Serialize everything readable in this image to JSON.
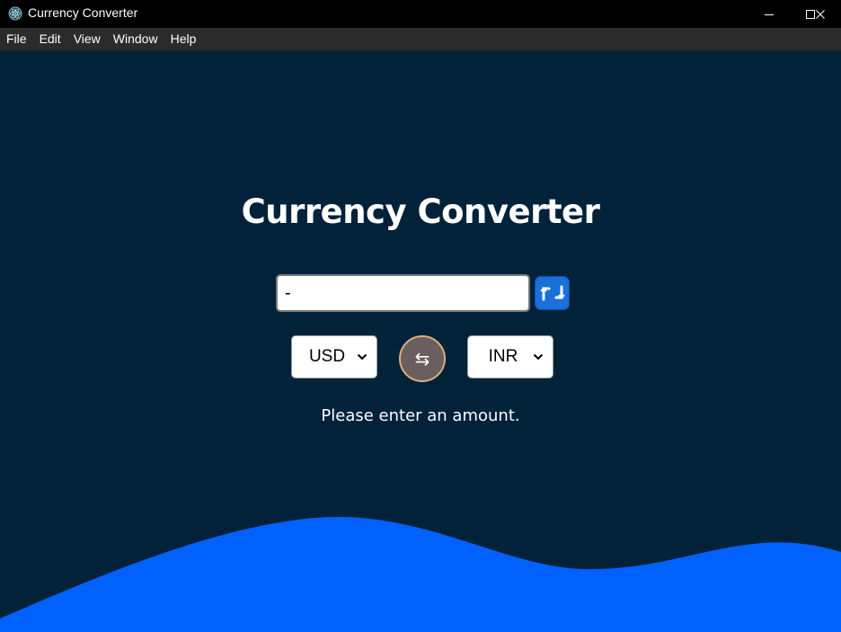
{
  "window": {
    "title": "Currency Converter",
    "icon": "electron-icon"
  },
  "menu": {
    "items": [
      "File",
      "Edit",
      "View",
      "Window",
      "Help"
    ]
  },
  "converter": {
    "heading": "Currency Converter",
    "amount_value": "-",
    "from_currency": "USD",
    "to_currency": "INR",
    "swap_symbol": "⇆",
    "message": "Please enter an amount."
  },
  "colors": {
    "background": "#02223a",
    "wave": "#0061ff",
    "swap_amount_button": "#1a6fd9",
    "swap_currency_button": "#6a5f5e",
    "swap_currency_border": "#d9b07a"
  }
}
